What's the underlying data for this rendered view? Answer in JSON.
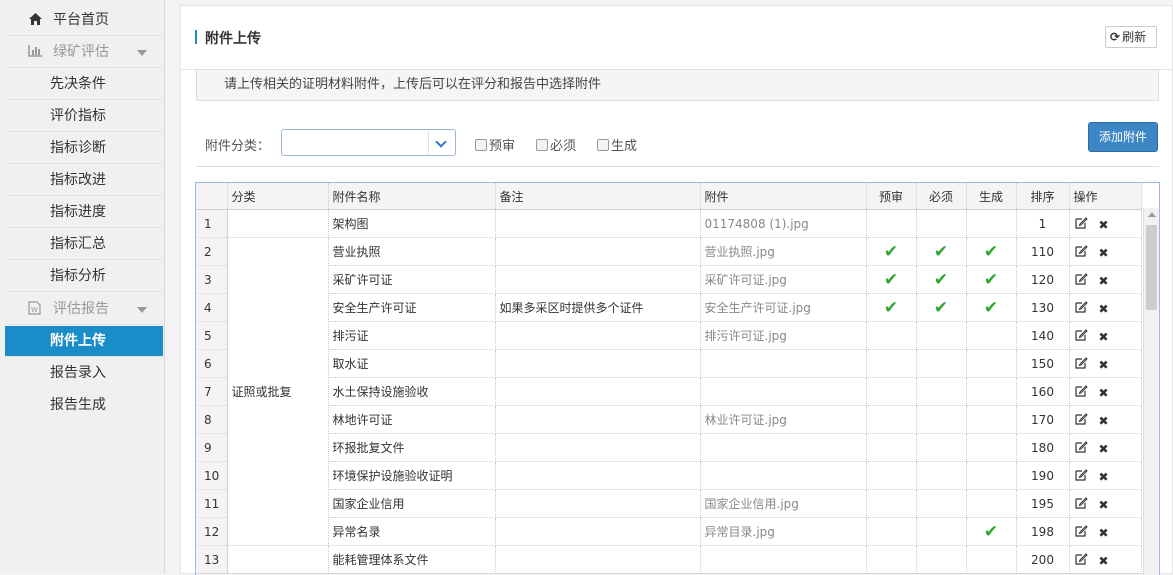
{
  "sidebar": {
    "home": {
      "label": "平台首页",
      "icon": "home-icon"
    },
    "group_eval": {
      "label": "绿矿评估",
      "icon": "bar-chart-icon"
    },
    "eval_items": [
      "先决条件",
      "评价指标",
      "指标诊断",
      "指标改进",
      "指标进度",
      "指标汇总",
      "指标分析"
    ],
    "group_report": {
      "label": "评估报告",
      "icon": "word-doc-icon"
    },
    "report_items": [
      "附件上传",
      "报告录入",
      "报告生成"
    ],
    "active": "附件上传"
  },
  "header": {
    "title": "附件上传",
    "refresh_label": "刷新"
  },
  "notice": "请上传相关的证明材料附件，上传后可以在评分和报告中选择附件",
  "filter": {
    "label": "附件分类：",
    "select_value": "",
    "checkboxes": [
      "预审",
      "必须",
      "生成"
    ],
    "add_label": "添加附件"
  },
  "table": {
    "columns": [
      "分类",
      "附件名称",
      "备注",
      "附件",
      "预审",
      "必须",
      "生成",
      "排序",
      "操作"
    ],
    "category_merged": "证照或批复",
    "rows": [
      {
        "no": "1",
        "cat": "",
        "name": "架构图",
        "note": "",
        "file": "01174808 (1).jpg",
        "pre": false,
        "req": false,
        "gen": false,
        "order": "1"
      },
      {
        "no": "2",
        "cat": "证照或批复",
        "name": "营业执照",
        "note": "",
        "file": "营业执照.jpg",
        "pre": true,
        "req": true,
        "gen": true,
        "order": "110"
      },
      {
        "no": "3",
        "cat": "证照或批复",
        "name": "采矿许可证",
        "note": "",
        "file": "采矿许可证.jpg",
        "pre": true,
        "req": true,
        "gen": true,
        "order": "120"
      },
      {
        "no": "4",
        "cat": "证照或批复",
        "name": "安全生产许可证",
        "note": "如果多采区时提供多个证件",
        "file": "安全生产许可证.jpg",
        "pre": true,
        "req": true,
        "gen": true,
        "order": "130"
      },
      {
        "no": "5",
        "cat": "证照或批复",
        "name": "排污证",
        "note": "",
        "file": "排污许可证.jpg",
        "pre": false,
        "req": false,
        "gen": false,
        "order": "140"
      },
      {
        "no": "6",
        "cat": "证照或批复",
        "name": "取水证",
        "note": "",
        "file": "",
        "pre": false,
        "req": false,
        "gen": false,
        "order": "150"
      },
      {
        "no": "7",
        "cat": "证照或批复",
        "name": "水土保持设施验收",
        "note": "",
        "file": "",
        "pre": false,
        "req": false,
        "gen": false,
        "order": "160"
      },
      {
        "no": "8",
        "cat": "证照或批复",
        "name": "林地许可证",
        "note": "",
        "file": "林业许可证.jpg",
        "pre": false,
        "req": false,
        "gen": false,
        "order": "170"
      },
      {
        "no": "9",
        "cat": "证照或批复",
        "name": "环报批复文件",
        "note": "",
        "file": "",
        "pre": false,
        "req": false,
        "gen": false,
        "order": "180"
      },
      {
        "no": "10",
        "cat": "证照或批复",
        "name": "环境保护设施验收证明",
        "note": "",
        "file": "",
        "pre": false,
        "req": false,
        "gen": false,
        "order": "190"
      },
      {
        "no": "11",
        "cat": "证照或批复",
        "name": "国家企业信用",
        "note": "",
        "file": "国家企业信用.jpg",
        "pre": false,
        "req": false,
        "gen": false,
        "order": "195"
      },
      {
        "no": "12",
        "cat": "证照或批复",
        "name": "异常名录",
        "note": "",
        "file": "异常目录.jpg",
        "pre": false,
        "req": false,
        "gen": true,
        "order": "198"
      },
      {
        "no": "13",
        "cat": "",
        "name": "能耗管理体系文件",
        "note": "",
        "file": "",
        "pre": false,
        "req": false,
        "gen": false,
        "order": "200"
      }
    ]
  }
}
